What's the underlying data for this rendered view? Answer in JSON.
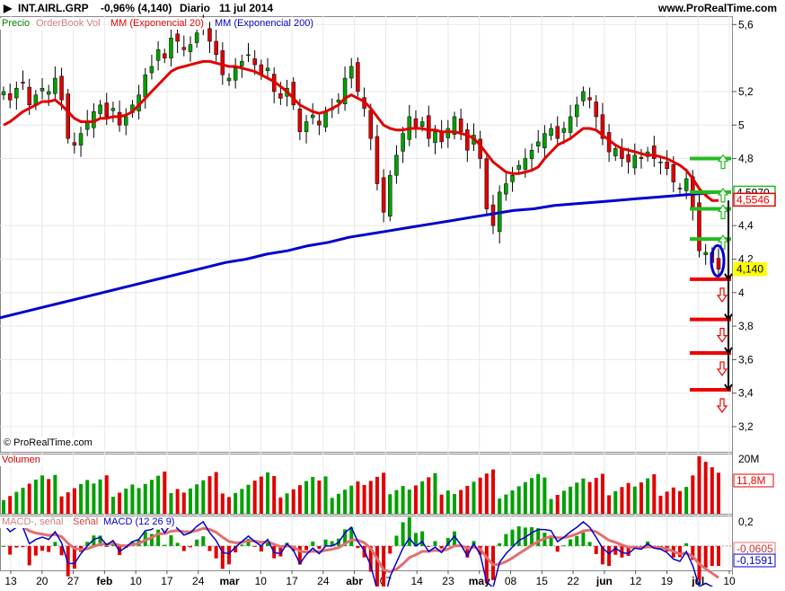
{
  "header": {
    "instrument": "INT.AIRL.GRP",
    "change": "-0,96% (4,140)",
    "period": "Diario",
    "date": "11 jul 2014",
    "site": "www.ProRealTime.com"
  },
  "watermark": "© ProRealTime.com",
  "legends": {
    "price": [
      "Precio",
      "OrderBook Vol",
      "MM (Exponencial 20)",
      "MM (Exponencial 200)"
    ],
    "volume": [
      "Volumen"
    ],
    "macd": [
      "MACD-, señal",
      "Señal",
      "MACD (12 26 9)"
    ]
  },
  "colors": {
    "up": "#00a000",
    "down": "#e00000",
    "ema20": "#e00000",
    "ema200": "#0000cc",
    "green_level": "#22bb22",
    "red_level": "#ee0000",
    "price_label_bg": "#ffff00",
    "grid": "#e8e8e8"
  },
  "chart_data": [
    {
      "type": "candlestick",
      "panel": "price",
      "x_ticks": [
        "13",
        "20",
        "27",
        "feb",
        "10",
        "17",
        "24",
        "mar",
        "10",
        "17",
        "24",
        "abr",
        "07",
        "14",
        "23",
        "may",
        "08",
        "15",
        "22",
        "jun",
        "12",
        "19",
        "jul",
        "10"
      ],
      "y_ticks": [
        "5,6",
        "5,2",
        "5",
        "4,8",
        "4,4",
        "4,2",
        "4",
        "3,8",
        "3,6",
        "3,4",
        "3,2"
      ],
      "ylim": [
        3.05,
        5.65
      ],
      "price_tags": [
        "4,5970",
        "4,5546",
        "4,140"
      ],
      "ema20_label": "MM (Exponencial 20)",
      "ema200_label": "MM (Exponencial 200)",
      "closes": [
        5.2,
        5.15,
        5.22,
        5.25,
        5.12,
        5.18,
        5.22,
        5.2,
        5.28,
        5.15,
        4.92,
        4.88,
        4.95,
        5.02,
        5.08,
        5.12,
        5.05,
        5.1,
        5.0,
        5.05,
        5.12,
        5.18,
        5.3,
        5.35,
        5.45,
        5.4,
        5.52,
        5.5,
        5.45,
        5.48,
        5.55,
        5.6,
        5.5,
        5.42,
        5.3,
        5.28,
        5.34,
        5.38,
        5.42,
        5.36,
        5.3,
        5.34,
        5.2,
        5.16,
        5.22,
        5.12,
        4.96,
        5.02,
        5.06,
        5.0,
        5.08,
        5.1,
        5.15,
        5.28,
        5.35,
        5.2,
        5.1,
        4.92,
        4.65,
        4.48,
        4.7,
        4.82,
        4.95,
        5.05,
        4.98,
        5.02,
        4.92,
        4.96,
        4.9,
        4.98,
        5.05,
        4.96,
        4.85,
        4.94,
        4.8,
        4.5,
        4.4,
        4.6,
        4.65,
        4.7,
        4.76,
        4.8,
        4.85,
        4.9,
        4.95,
        4.98,
        4.92,
        4.98,
        5.05,
        5.12,
        5.2,
        5.15,
        5.05,
        4.92,
        4.84,
        4.86,
        4.8,
        4.78,
        4.82,
        4.8,
        4.84,
        4.8,
        4.78,
        4.74,
        4.66,
        4.62,
        4.68,
        4.5,
        4.25,
        4.24,
        4.18,
        4.14
      ],
      "ema20": [
        5.0,
        5.02,
        5.05,
        5.08,
        5.1,
        5.12,
        5.14,
        5.14,
        5.15,
        5.12,
        5.08,
        5.04,
        5.02,
        5.02,
        5.02,
        5.04,
        5.04,
        5.05,
        5.05,
        5.06,
        5.08,
        5.12,
        5.16,
        5.2,
        5.24,
        5.28,
        5.32,
        5.34,
        5.35,
        5.36,
        5.37,
        5.38,
        5.38,
        5.37,
        5.36,
        5.35,
        5.35,
        5.34,
        5.33,
        5.32,
        5.3,
        5.28,
        5.26,
        5.23,
        5.2,
        5.16,
        5.12,
        5.1,
        5.08,
        5.07,
        5.08,
        5.1,
        5.12,
        5.16,
        5.18,
        5.16,
        5.14,
        5.1,
        5.05,
        5.0,
        4.98,
        4.97,
        4.97,
        4.98,
        4.98,
        4.98,
        4.97,
        4.97,
        4.96,
        4.96,
        4.96,
        4.95,
        4.94,
        4.92,
        4.88,
        4.83,
        4.78,
        4.75,
        4.72,
        4.71,
        4.71,
        4.72,
        4.73,
        4.75,
        4.8,
        4.84,
        4.88,
        4.9,
        4.92,
        4.95,
        4.98,
        4.98,
        4.97,
        4.94,
        4.91,
        4.88,
        4.86,
        4.85,
        4.84,
        4.83,
        4.82,
        4.82,
        4.81,
        4.8,
        4.78,
        4.76,
        4.73,
        4.68,
        4.62,
        4.58,
        4.55,
        4.55
      ],
      "ema200": [
        3.85,
        3.88,
        3.91,
        3.94,
        3.97,
        4.0,
        4.03,
        4.06,
        4.09,
        4.12,
        4.15,
        4.18,
        4.2,
        4.23,
        4.25,
        4.28,
        4.3,
        4.33,
        4.35,
        4.37,
        4.39,
        4.41,
        4.43,
        4.45,
        4.47,
        4.49,
        4.5,
        4.52,
        4.53,
        4.54,
        4.55,
        4.56,
        4.57,
        4.58,
        4.59,
        4.6
      ],
      "supports_green": [
        4.8,
        4.6,
        4.5,
        4.32
      ],
      "supports_red": [
        4.08,
        3.84,
        3.64,
        3.42
      ]
    },
    {
      "type": "bar",
      "panel": "volume",
      "title": "Volumen",
      "y_ticks": [
        "20M"
      ],
      "value_tag": "11,8M",
      "ylim": [
        0,
        22
      ]
    },
    {
      "type": "bar",
      "panel": "macd",
      "title": "MACD (12 26 9)",
      "y_ticks": [
        "0,2"
      ],
      "value_tags": [
        "-0,0605",
        "-0,1591"
      ],
      "ylim": [
        -0.2,
        0.25
      ]
    }
  ]
}
